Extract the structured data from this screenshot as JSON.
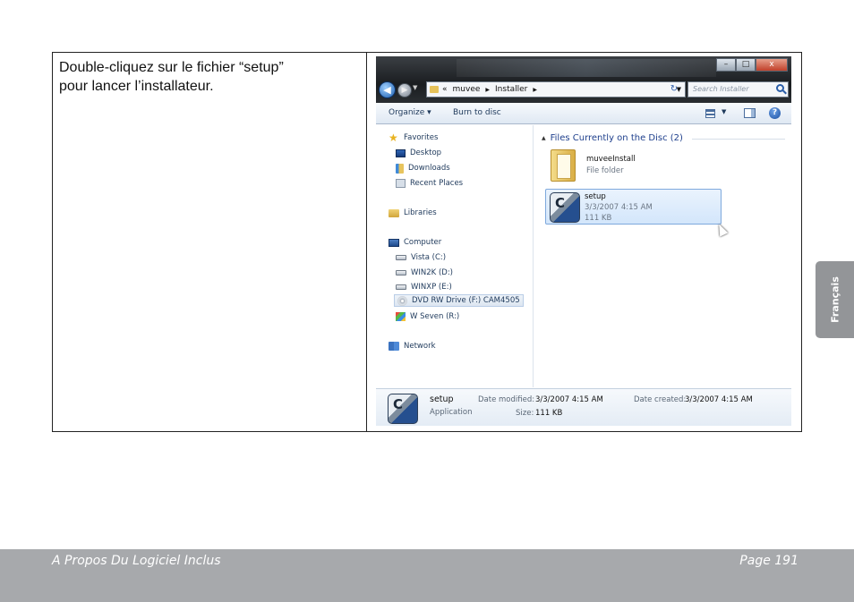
{
  "instruction": {
    "line1": "Double-cliquez sur le fichier “setup”",
    "line2": "pour lancer l’installateur."
  },
  "explorer": {
    "window_buttons": {
      "minimize": "–",
      "maximize": "□",
      "close": "x"
    },
    "address": {
      "prefix": "«",
      "segments": [
        "muvee",
        "Installer"
      ]
    },
    "search_placeholder": "Search Installer",
    "toolbar": {
      "organize": "Organize ▾",
      "burn": "Burn to disc"
    },
    "nav": {
      "favorites": "Favorites",
      "desktop": "Desktop",
      "downloads": "Downloads",
      "recent": "Recent Places",
      "libraries": "Libraries",
      "computer": "Computer",
      "drive_c": "Vista (C:)",
      "drive_d": "WIN2K (D:)",
      "drive_e": "WINXP (E:)",
      "drive_f": "DVD RW Drive (F:) CAM4505",
      "drive_r": "W Seven (R:)",
      "network": "Network"
    },
    "group_header": "Files Currently on the Disc (2)",
    "files": [
      {
        "name": "muveeInstall",
        "type": "File folder"
      },
      {
        "name": "setup",
        "date": "3/3/2007 4:15 AM",
        "size": "111 KB"
      }
    ],
    "details": {
      "name": "setup",
      "type": "Application",
      "modified_label": "Date modified:",
      "modified_value": "3/3/2007 4:15 AM",
      "size_label": "Size:",
      "size_value": "111 KB",
      "created_label": "Date created:",
      "created_value": "3/3/2007 4:15 AM"
    }
  },
  "side_tab": "Français",
  "footer": {
    "section": "A Propos Du Logiciel Inclus",
    "page": "Page 191"
  }
}
